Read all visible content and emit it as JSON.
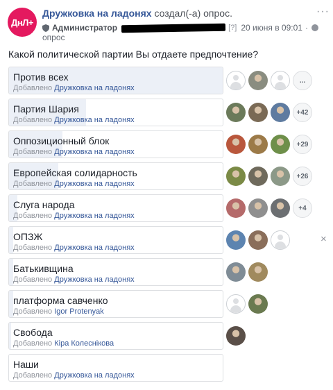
{
  "header": {
    "logo_text": "ДнЛ+",
    "page_name": "Дружковка на ладонях",
    "action": " создал(-а) опрос.",
    "admin_label": "Администратор",
    "help_mark": "[?]",
    "timestamp": "20 июня в 09:01",
    "separator": "·",
    "type_label": "опрос",
    "more": "···"
  },
  "poll": {
    "question": "Какой политической партии Вы отдаете предпочтение?",
    "added_prefix": "Добавлено",
    "options": [
      {
        "label": "Против всех",
        "added_by": "Дружковка на ладонях",
        "fill": 1.0,
        "voters": [
          "empty",
          "#8a8d80",
          "empty"
        ],
        "more": "...",
        "remove": ""
      },
      {
        "label": "Партия Шария",
        "added_by": "Дружковка на ладонях",
        "fill": 0.36,
        "voters": [
          "#6b7a5a",
          "#7a6a55",
          "#5e7ba0"
        ],
        "more": "+42",
        "remove": ""
      },
      {
        "label": "Оппозиционный блок",
        "added_by": "Дружковка на ладонях",
        "fill": 0.25,
        "voters": [
          "#b9573c",
          "#9c7a48",
          "#6e8f4a"
        ],
        "more": "+29",
        "remove": ""
      },
      {
        "label": "Европейская солидарность",
        "added_by": "Дружковка на ладонях",
        "fill": 0.23,
        "voters": [
          "#7b8a46",
          "#6f6a5c",
          "#8c9988"
        ],
        "more": "+26",
        "remove": ""
      },
      {
        "label": "Слуга народа",
        "added_by": "Дружковка на ладонях",
        "fill": 0.04,
        "voters": [
          "#b56a6a",
          "#8f8f8f",
          "#6c6f72"
        ],
        "more": "+4",
        "remove": ""
      },
      {
        "label": "ОПЗЖ",
        "added_by": "Дружковка на ладонях",
        "fill": 0.02,
        "voters": [
          "#5d84b0",
          "#8a6e5a",
          "empty"
        ],
        "more": "",
        "remove": "×"
      },
      {
        "label": "Батькивщина",
        "added_by": "Дружковка на ладонях",
        "fill": 0.02,
        "voters": [
          "#7f8c96",
          "#a08a5e"
        ],
        "more": "",
        "remove": ""
      },
      {
        "label": "платформа савченко",
        "added_by": "Igor Protenyak",
        "fill": 0.02,
        "voters": [
          "empty",
          "#6a7a50"
        ],
        "more": "",
        "remove": ""
      },
      {
        "label": "Свобода",
        "added_by": "Кіра Колеснікова",
        "fill": 0.01,
        "voters": [
          "#5a4f48"
        ],
        "more": "",
        "remove": ""
      },
      {
        "label": "Наши",
        "added_by": "Дружковка на ладонях",
        "fill": 0.0,
        "voters": [],
        "more": "",
        "remove": ""
      }
    ]
  }
}
